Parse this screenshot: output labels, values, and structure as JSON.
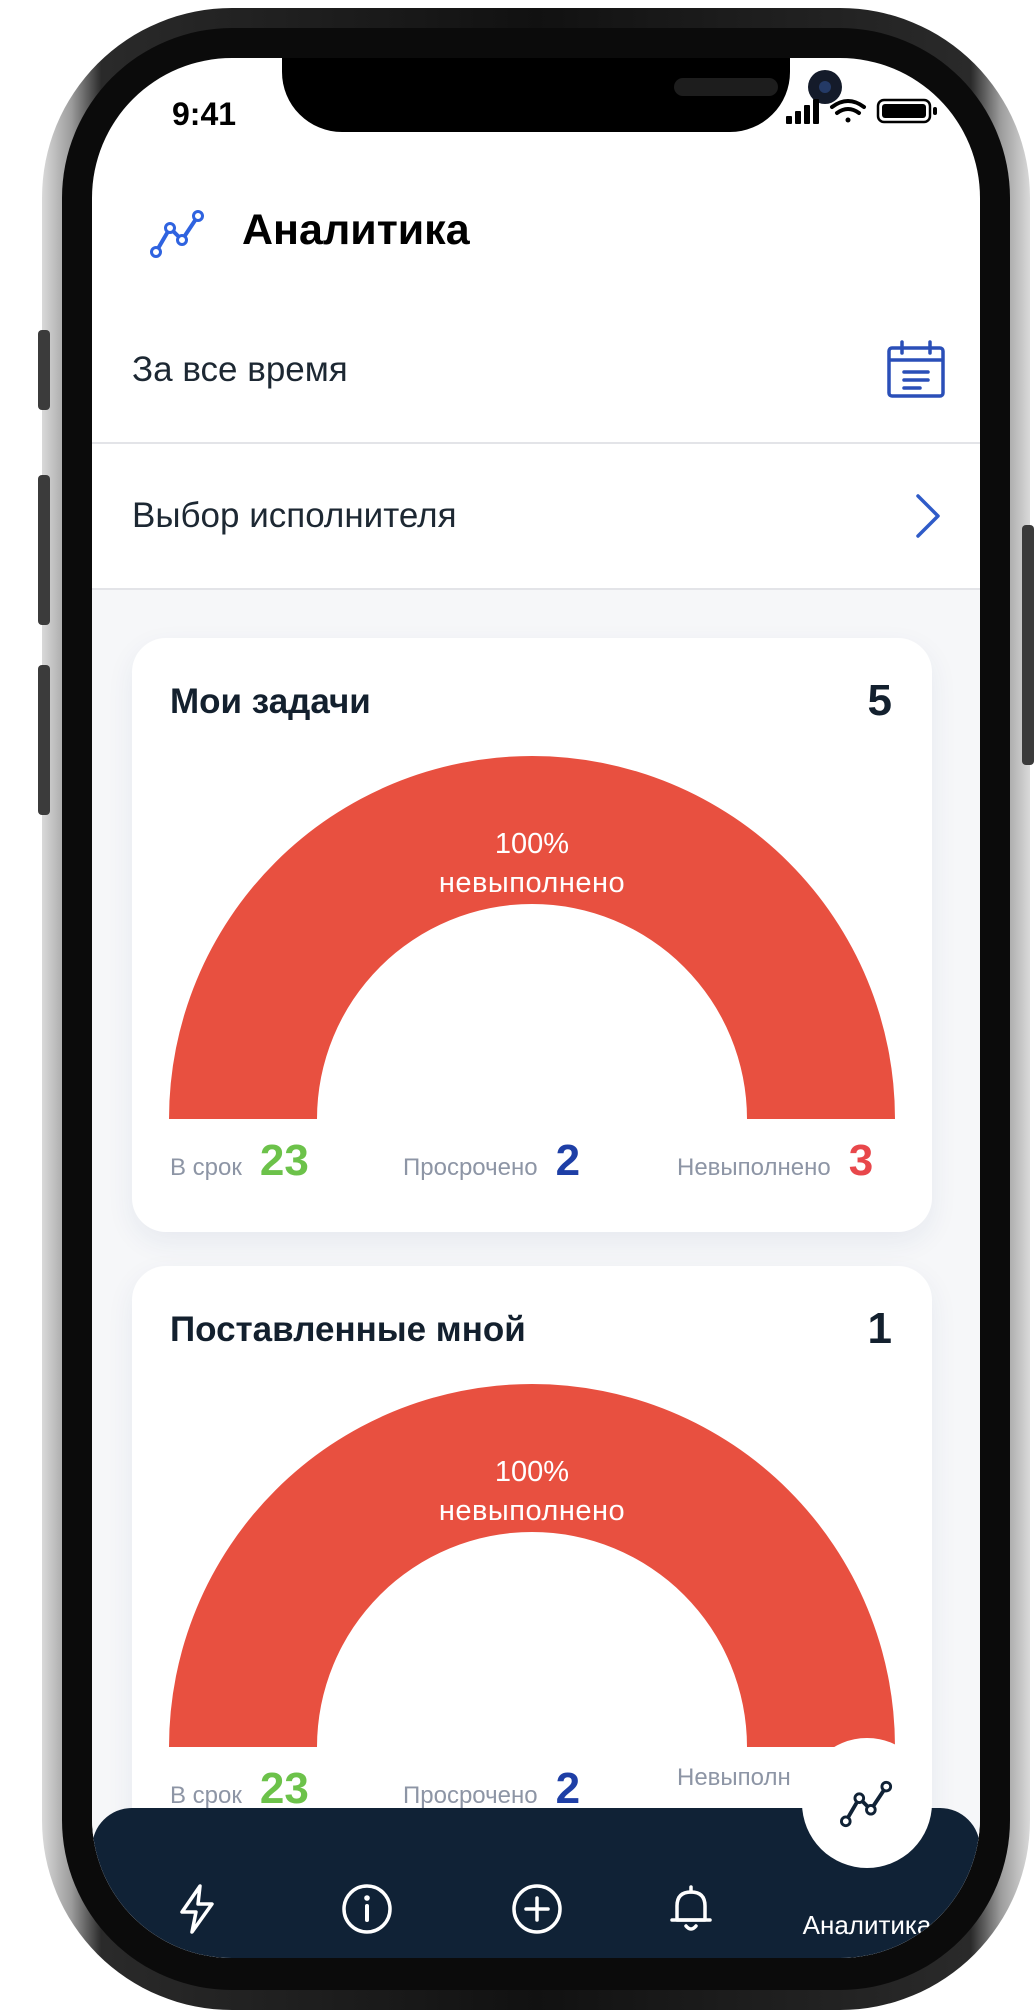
{
  "status_bar": {
    "time": "9:41"
  },
  "header": {
    "title": "Аналитика",
    "icon": "analytics-chart-icon"
  },
  "filters": {
    "period_label": "За все время",
    "period_icon": "calendar-icon",
    "executor_label": "Выбор исполнителя",
    "executor_icon": "chevron-right-icon"
  },
  "cards": [
    {
      "title": "Мои задачи",
      "count": "5",
      "gauge_percent": "100%",
      "gauge_label": "невыполнено",
      "stats": [
        {
          "label": "В срок",
          "value": "23",
          "color": "#6cc24a"
        },
        {
          "label": "Просрочено",
          "value": "2",
          "color": "#1e3fa6"
        },
        {
          "label": "Невыполнено",
          "value": "3",
          "color": "#e8474b"
        }
      ]
    },
    {
      "title": "Поставленные мной",
      "count": "1",
      "gauge_percent": "100%",
      "gauge_label": "невыполнено",
      "stats": [
        {
          "label": "В срок",
          "value": "23",
          "color": "#6cc24a"
        },
        {
          "label": "Просрочено",
          "value": "2",
          "color": "#1e3fa6"
        },
        {
          "label": "Невыполн",
          "value": "",
          "color": "#e8474b"
        }
      ]
    }
  ],
  "tabbar": {
    "items": [
      {
        "icon": "lightning-icon"
      },
      {
        "icon": "info-icon"
      },
      {
        "icon": "plus-circle-icon"
      },
      {
        "icon": "bell-icon"
      },
      {
        "icon": "analytics-chart-icon",
        "label": "Аналитика",
        "active": true
      }
    ]
  },
  "colors": {
    "accent": "#2f63e0",
    "gauge": "#e85040",
    "tabbar_bg": "#102236"
  }
}
